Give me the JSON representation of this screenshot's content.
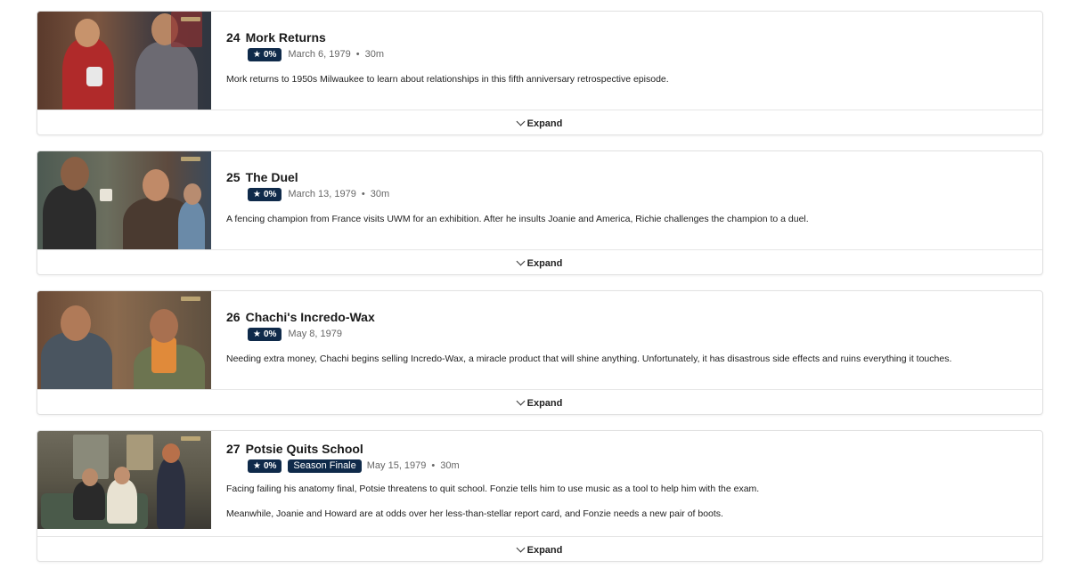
{
  "episodes": [
    {
      "number": "24",
      "title": "Mork Returns",
      "rating": "0%",
      "date": "March 6, 1979",
      "runtime": "30m",
      "badge": "",
      "description": [
        "Mork returns to 1950s Milwaukee to learn about relationships in this fifth anniversary retrospective episode."
      ],
      "expand_label": "Expand"
    },
    {
      "number": "25",
      "title": "The Duel",
      "rating": "0%",
      "date": "March 13, 1979",
      "runtime": "30m",
      "badge": "",
      "description": [
        "A fencing champion from France visits UWM for an exhibition. After he insults Joanie and America, Richie challenges the champion to a duel."
      ],
      "expand_label": "Expand"
    },
    {
      "number": "26",
      "title": "Chachi's Incredo-Wax",
      "rating": "0%",
      "date": "May 8, 1979",
      "runtime": "",
      "badge": "",
      "description": [
        "Needing extra money, Chachi begins selling Incredo-Wax, a miracle product that will shine anything. Unfortunately, it has disastrous side effects and ruins everything it touches."
      ],
      "expand_label": "Expand"
    },
    {
      "number": "27",
      "title": "Potsie Quits School",
      "rating": "0%",
      "date": "May 15, 1979",
      "runtime": "30m",
      "badge": "Season Finale",
      "description": [
        "Facing failing his anatomy final, Potsie threatens to quit school. Fonzie tells him to use music as a tool to help him with the exam.",
        "Meanwhile, Joanie and Howard are at odds over her less-than-stellar report card, and Fonzie needs a new pair of boots."
      ],
      "expand_label": "Expand"
    }
  ],
  "icons": {
    "rating": "star-icon",
    "expand": "chevron-down-icon"
  },
  "colors": {
    "badge_bg": "#0f2a4a",
    "badge_text": "#ffffff",
    "card_border": "#e1e1e1"
  }
}
